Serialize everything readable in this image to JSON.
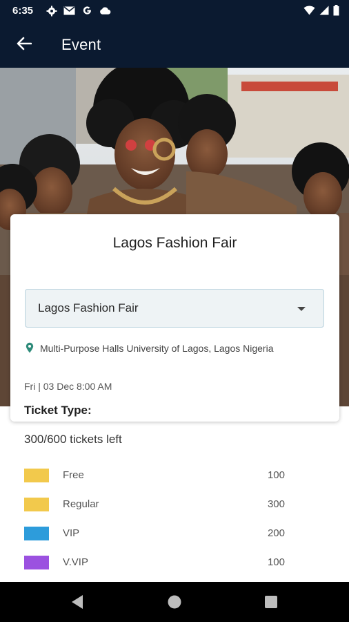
{
  "status_bar": {
    "time": "6:35",
    "icons": [
      "gear-icon",
      "gmail-icon",
      "google-icon",
      "cloud-icon",
      "wifi-icon",
      "signal-icon",
      "battery-icon"
    ]
  },
  "app_bar": {
    "title": "Event",
    "back_icon": "arrow-left-icon"
  },
  "event": {
    "title": "Lagos Fashion Fair",
    "selected_event": "Lagos Fashion Fair",
    "location": "Multi-Purpose Halls University of Lagos, Lagos Nigeria",
    "date": "Fri | 03 Dec 8:00 AM"
  },
  "tickets": {
    "heading": "Ticket Type:",
    "remaining": "300/600 tickets left",
    "items": [
      {
        "name": "Free",
        "count": "100",
        "color": "#f2c94c"
      },
      {
        "name": "Regular",
        "count": "300",
        "color": "#f2c94c"
      },
      {
        "name": "VIP",
        "count": "200",
        "color": "#2d9cdb"
      },
      {
        "name": "V.VIP",
        "count": "100",
        "color": "#9b51e0"
      }
    ]
  },
  "colors": {
    "app_bar": "#0b1a30",
    "pin": "#2e8b7a"
  }
}
